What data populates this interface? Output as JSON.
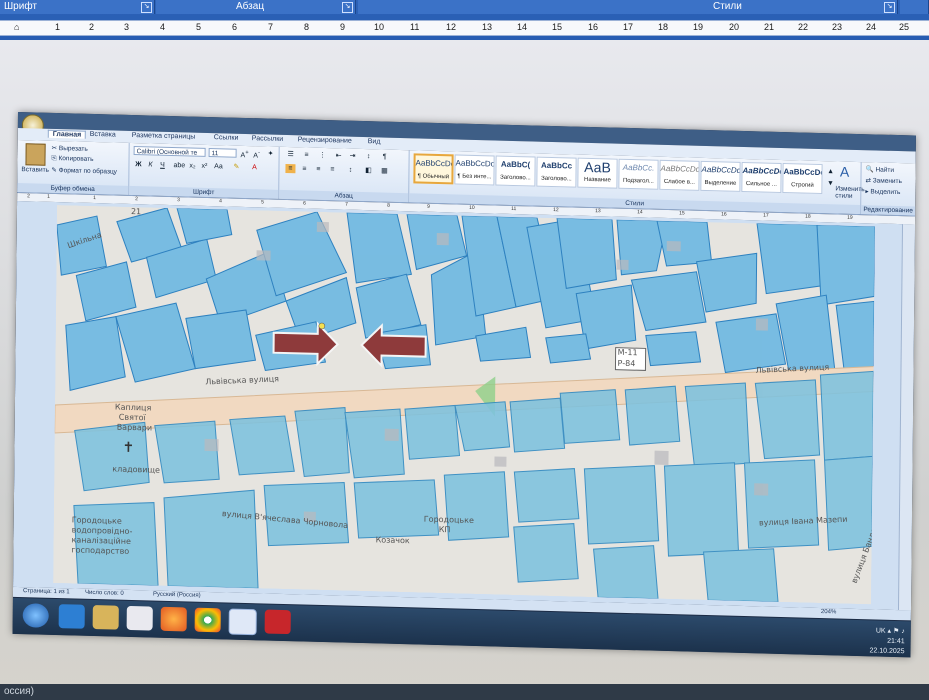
{
  "outer": {
    "groups": [
      {
        "label": "Шрифт"
      },
      {
        "label": "Абзац"
      },
      {
        "label": "Стили"
      }
    ],
    "ruler": [
      "1",
      "2",
      "3",
      "4",
      "5",
      "6",
      "7",
      "8",
      "9",
      "10",
      "11",
      "12",
      "13",
      "14",
      "15",
      "16",
      "17",
      "18",
      "19",
      "20",
      "21",
      "22",
      "23",
      "24",
      "25"
    ],
    "status_lang_fragment": "оссия)"
  },
  "word": {
    "tabs": [
      "Главная",
      "Вставка",
      "Разметка страницы",
      "Ссылки",
      "Рассылки",
      "Рецензирование",
      "Вид"
    ],
    "clipboard": {
      "paste": "Вставить",
      "cut": "Вырезать",
      "copy": "Копировать",
      "format_painter": "Формат по образцу",
      "group_label": "Буфер обмена"
    },
    "font": {
      "family": "Calibri (Основной те",
      "size": "11",
      "group_label": "Шрифт"
    },
    "paragraph": {
      "group_label": "Абзац"
    },
    "styles": {
      "items": [
        {
          "sample": "AaBbCcDc",
          "name": "¶ Обычный"
        },
        {
          "sample": "AaBbCcDc",
          "name": "¶ Без инте..."
        },
        {
          "sample": "AaBbC(",
          "name": "Заголово..."
        },
        {
          "sample": "AaBbCc",
          "name": "Заголово..."
        },
        {
          "sample": "АаВ",
          "name": "Название"
        },
        {
          "sample": "AaBbCc.",
          "name": "Подзагол..."
        },
        {
          "sample": "AaBbCcDc",
          "name": "Слабое в..."
        },
        {
          "sample": "AaBbCcDc",
          "name": "Выделение"
        },
        {
          "sample": "AaBbCcDc",
          "name": "Сильное ..."
        },
        {
          "sample": "AaBbCcDc",
          "name": "Строгий"
        }
      ],
      "change_styles": "Изменить стили",
      "group_label": "Стили"
    },
    "editing": {
      "find": "Найти",
      "replace": "Заменить",
      "select": "Выделить",
      "group_label": "Редактирование"
    },
    "ruler": [
      "2",
      "1",
      "1",
      "2",
      "3",
      "4",
      "5",
      "6",
      "7",
      "8",
      "9",
      "10",
      "11",
      "12",
      "13",
      "14",
      "15",
      "16",
      "17",
      "18",
      "19"
    ],
    "status": {
      "page": "Страница: 1 из 1",
      "words": "Число слов: 0",
      "language": "Русский (Россия)",
      "zoom": "204%"
    },
    "taskbar": {
      "lang": "UK",
      "time": "21:41",
      "date": "22.10.2025"
    }
  },
  "map": {
    "labels": {
      "street_lviv_left": "Львівська вулиця",
      "street_lviv_right": "Львівська вулиця",
      "road_code_1": "М-11",
      "road_code_2": "Р-84",
      "chapel_1": "Каплиця",
      "chapel_2": "Святої",
      "chapel_3": "Варвари",
      "cemetery": "кладовище",
      "street_chornovil": "вулиця В'ячеслава Чорновола",
      "kozachok": "Козачок",
      "water_1": "Городоцьке",
      "water_2": "водопровідно-",
      "water_3": "каналізаційне",
      "water_4": "господарство",
      "gorod_kp_1": "Городоцьке",
      "gorod_kp_2": "КП",
      "mazepa": "вулиця Івана Мазепи",
      "bandera": "вулиця Бандери",
      "top_street": "Шкільна",
      "house_21": "21"
    }
  },
  "colors": {
    "parcel_fill": "#6fb9e2",
    "parcel_stroke": "#1f79bd",
    "road": "#f1d9c1",
    "arrow": "#8e3a3b",
    "map_bg": "#e6e4df"
  }
}
